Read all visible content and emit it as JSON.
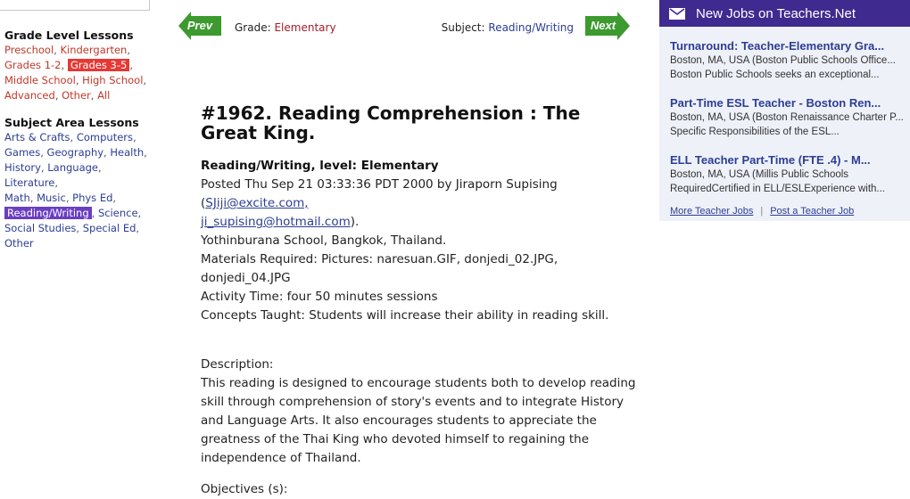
{
  "sidebar": {
    "grade_heading": "Grade Level Lessons",
    "grades": [
      "Preschool",
      "Kindergarten",
      "Grades 1-2",
      "Grades 3-5",
      "Middle School",
      "High School",
      "Advanced",
      "Other",
      "All"
    ],
    "subject_heading": "Subject Area Lessons",
    "subjects": [
      "Arts & Crafts",
      "Computers",
      "Games",
      "Geography",
      "Health",
      "History",
      "Language",
      "Literature",
      "Math",
      "Music",
      "Phys Ed",
      "Reading/Writing",
      "Science",
      "Social Studies",
      "Special Ed",
      "Other"
    ]
  },
  "nav": {
    "prev_label": "Prev",
    "next_label": "Next",
    "grade_prefix": "Grade:",
    "grade_value": "Elementary",
    "subject_prefix": "Subject:",
    "subject_value": "Reading/Writing"
  },
  "article": {
    "title": "#1962. Reading Comprehension : The Great King.",
    "level_line": "Reading/Writing, level: Elementary",
    "posted_prefix": "Posted Thu Sep 21 03:33:36 PDT 2000 by Jiraporn Supising (",
    "email_1": "SJiji@excite.com,",
    "email_2": "ji_supising@hotmail.com",
    "posted_suffix": ").",
    "school": "Yothinburana School, Bangkok, Thailand.",
    "materials": "Materials Required: Pictures: naresuan.GIF, donjedi_02.JPG, donjedi_04.JPG",
    "activity_time": "Activity Time: four 50 minutes sessions",
    "concepts": "Concepts Taught: Students will increase their ability in reading skill.",
    "description_label": "Description:",
    "description_lines": [
      "This reading is designed to encourage students both to develop reading",
      "skill through comprehension of story's events and to integrate History",
      "and Language Arts. It also encourages students to appreciate the",
      "greatness of the Thai King who devoted himself to regaining the",
      "independence of Thailand."
    ],
    "objectives_label": "Objectives (s):"
  },
  "jobs": {
    "header": "New Jobs on Teachers.Net",
    "items": [
      {
        "title": "Turnaround: Teacher-Elementary Gra...",
        "location": "Boston, MA, USA (Boston Public Schools Office...",
        "desc": "Boston Public Schools seeks an exceptional..."
      },
      {
        "title": "Part-Time ESL Teacher - Boston Ren...",
        "location": "Boston, MA, USA (Boston Renaissance Charter P...",
        "desc": "Specific Responsibilities of the ESL..."
      },
      {
        "title": "ELL Teacher Part-Time (FTE .4) - M...",
        "location": "Boston, MA, USA (Millis Public Schools",
        "desc": "RequiredCertified in ELL/ESLExperience with..."
      }
    ],
    "more_label": "More Teacher Jobs",
    "divider": "|",
    "post_label": "Post a Teacher Job"
  },
  "colors": {
    "nav_green": "#3c9a2e",
    "jobs_header": "#3f2a8f",
    "grade_link": "#c0392b",
    "subject_link": "#2c3e94",
    "highlight_grade": "#e53935",
    "highlight_subject": "#6a3ec2"
  }
}
